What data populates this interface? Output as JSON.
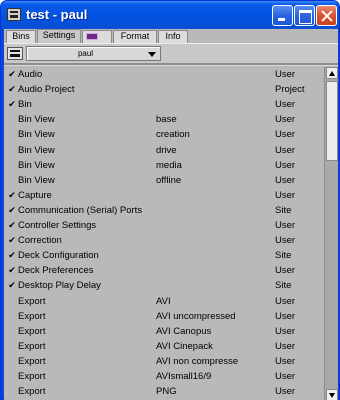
{
  "window": {
    "title": "test - paul",
    "icon": "settings-app-icon",
    "titlebar_color": "#0a5ae8",
    "controls": [
      "minimize",
      "maximize",
      "close"
    ]
  },
  "tabs": [
    {
      "label": "Bins",
      "active": false
    },
    {
      "label": "Settings",
      "active": true
    },
    {
      "label": "",
      "icon": "purple-monitor-icon",
      "active": false
    },
    {
      "label": "Format",
      "active": false
    },
    {
      "label": "Info",
      "active": false
    }
  ],
  "toolbar": {
    "user_dropdown_value": "paul"
  },
  "colors": {
    "list_background": "#b9b9b9",
    "tab_background": "#dcdcdc"
  },
  "settings": [
    {
      "check": "✔",
      "name": "Audio",
      "sub": "",
      "scope": "User"
    },
    {
      "check": "✔",
      "name": "Audio Project",
      "sub": "",
      "scope": "Project"
    },
    {
      "check": "✔",
      "name": "Bin",
      "sub": "",
      "scope": "User"
    },
    {
      "check": "",
      "name": "Bin View",
      "sub": "base",
      "scope": "User"
    },
    {
      "check": "",
      "name": "Bin View",
      "sub": "creation",
      "scope": "User"
    },
    {
      "check": "",
      "name": "Bin View",
      "sub": "drive",
      "scope": "User"
    },
    {
      "check": "",
      "name": "Bin View",
      "sub": "media",
      "scope": "User"
    },
    {
      "check": "",
      "name": "Bin View",
      "sub": "offline",
      "scope": "User"
    },
    {
      "check": "✔",
      "name": "Capture",
      "sub": "",
      "scope": "User"
    },
    {
      "check": "✔",
      "name": "Communication (Serial) Ports",
      "sub": "",
      "scope": "Site"
    },
    {
      "check": "✔",
      "name": "Controller Settings",
      "sub": "",
      "scope": "User"
    },
    {
      "check": "✔",
      "name": "Correction",
      "sub": "",
      "scope": "User"
    },
    {
      "check": "✔",
      "name": "Deck Configuration",
      "sub": "",
      "scope": "Site"
    },
    {
      "check": "✔",
      "name": "Deck Preferences",
      "sub": "",
      "scope": "User"
    },
    {
      "check": "✔",
      "name": "Desktop Play Delay",
      "sub": "",
      "scope": "Site"
    },
    {
      "check": "",
      "name": "Export",
      "sub": "AVI",
      "scope": "User"
    },
    {
      "check": "",
      "name": "Export",
      "sub": "AVI  uncompressed",
      "scope": "User"
    },
    {
      "check": "",
      "name": "Export",
      "sub": "AVI Canopus",
      "scope": "User"
    },
    {
      "check": "",
      "name": "Export",
      "sub": "AVI Cinepack",
      "scope": "User"
    },
    {
      "check": "",
      "name": "Export",
      "sub": "AVI non compresse",
      "scope": "User"
    },
    {
      "check": "",
      "name": "Export",
      "sub": "AVIsmall16/9",
      "scope": "User"
    },
    {
      "check": "",
      "name": "Export",
      "sub": "PNG",
      "scope": "User"
    }
  ]
}
